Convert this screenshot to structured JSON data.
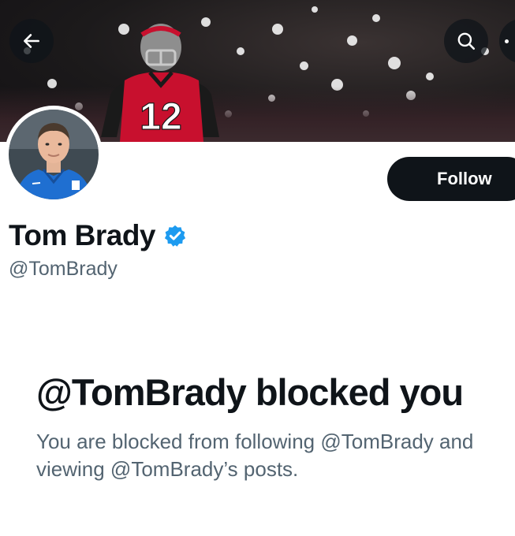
{
  "header": {
    "back_icon": "arrow-left-icon",
    "search_icon": "search-icon",
    "more_icon": "more-icon"
  },
  "banner": {
    "jersey_number": "12"
  },
  "profile": {
    "name": "Tom Brady",
    "handle": "@TomBrady",
    "verified_color": "#1d9bf0",
    "follow_label": "Follow"
  },
  "blocked": {
    "title": "@TomBrady blocked you",
    "description": "You are blocked from following @TomBrady and viewing @TomBrady’s posts."
  }
}
